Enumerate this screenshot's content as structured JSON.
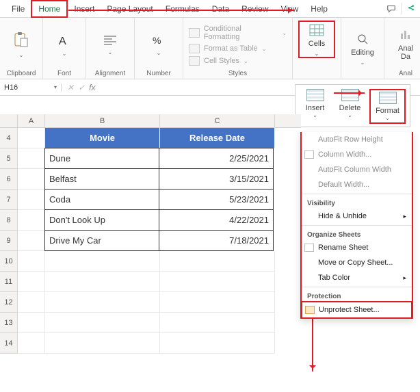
{
  "tabs": {
    "file": "File",
    "home": "Home",
    "insert": "Insert",
    "pageLayout": "Page Layout",
    "formulas": "Formulas",
    "data": "Data",
    "review": "Review",
    "view": "View",
    "help": "Help"
  },
  "ribbon": {
    "clipboard": "Clipboard",
    "font": "Font",
    "alignment": "Alignment",
    "number": "Number",
    "styles": "Styles",
    "condFmt": "Conditional Formatting",
    "asTable": "Format as Table",
    "cellStyles": "Cell Styles",
    "cells": "Cells",
    "editing": "Editing",
    "analyze1": "Anal",
    "analyze2": "Da",
    "analyzeLabel": "Anal"
  },
  "cellsPop": {
    "insert": "Insert",
    "delete": "Delete",
    "format": "Format"
  },
  "nameBox": "H16",
  "grid": {
    "colA": "A",
    "colB": "B",
    "colC": "C",
    "rowLabels": {
      "r4": "4",
      "r5": "5",
      "r6": "6",
      "r7": "7",
      "r8": "8",
      "r9": "9",
      "r10": "10",
      "r11": "11",
      "r12": "12",
      "r13": "13",
      "r14": "14"
    },
    "hdrB": "Movie",
    "hdrC": "Release Date",
    "rows": [
      {
        "b": "Dune",
        "c": "2/25/2021"
      },
      {
        "b": "Belfast",
        "c": "3/15/2021"
      },
      {
        "b": "Coda",
        "c": "5/23/2021"
      },
      {
        "b": "Don't Look Up",
        "c": "4/22/2021"
      },
      {
        "b": "Drive My Car",
        "c": "7/18/2021"
      }
    ]
  },
  "menu": {
    "autoFitRowH": "AutoFit Row Height",
    "colWidth": "Column Width...",
    "autoFitColW": "AutoFit Column Width",
    "defaultWidth": "Default Width...",
    "visibility": "Visibility",
    "hideUnhide": "Hide & Unhide",
    "organize": "Organize Sheets",
    "rename": "Rename Sheet",
    "moveCopy": "Move or Copy Sheet...",
    "tabColor": "Tab Color",
    "protection": "Protection",
    "unprotect": "Unprotect Sheet..."
  }
}
